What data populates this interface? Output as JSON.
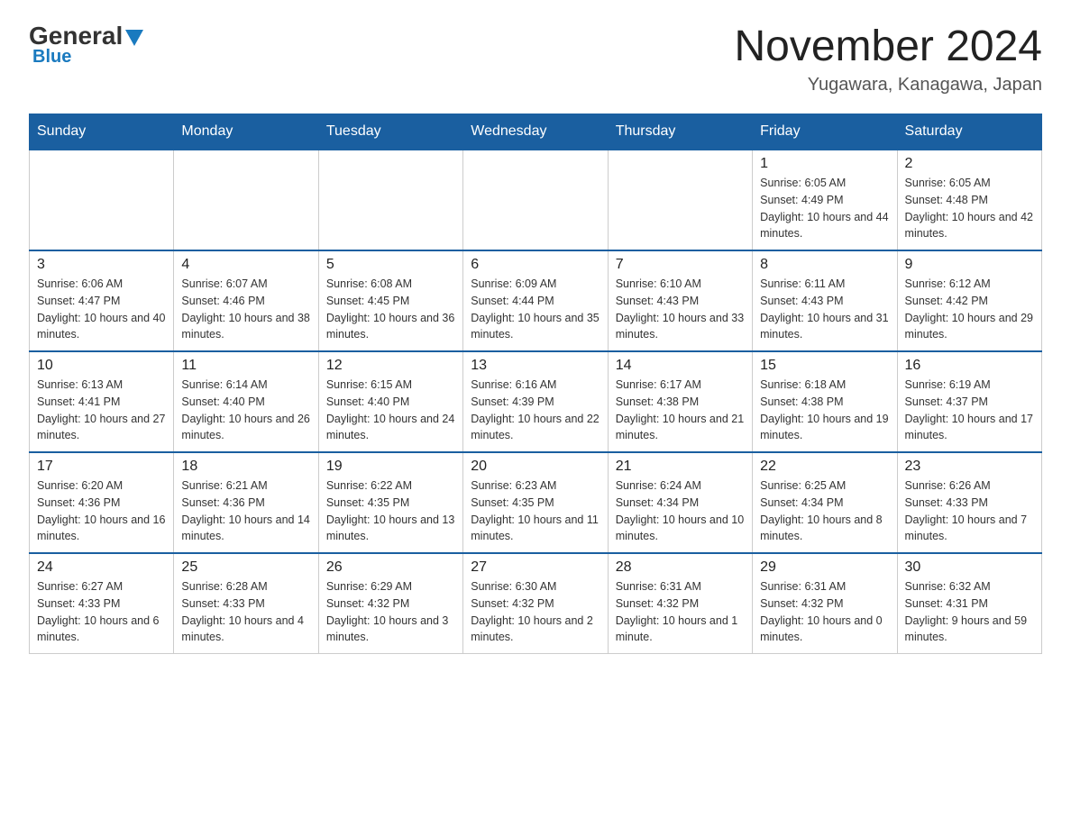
{
  "header": {
    "logo_general": "General",
    "logo_blue": "Blue",
    "month_title": "November 2024",
    "location": "Yugawara, Kanagawa, Japan"
  },
  "calendar": {
    "days_of_week": [
      "Sunday",
      "Monday",
      "Tuesday",
      "Wednesday",
      "Thursday",
      "Friday",
      "Saturday"
    ],
    "weeks": [
      [
        {
          "day": "",
          "info": ""
        },
        {
          "day": "",
          "info": ""
        },
        {
          "day": "",
          "info": ""
        },
        {
          "day": "",
          "info": ""
        },
        {
          "day": "",
          "info": ""
        },
        {
          "day": "1",
          "info": "Sunrise: 6:05 AM\nSunset: 4:49 PM\nDaylight: 10 hours and 44 minutes."
        },
        {
          "day": "2",
          "info": "Sunrise: 6:05 AM\nSunset: 4:48 PM\nDaylight: 10 hours and 42 minutes."
        }
      ],
      [
        {
          "day": "3",
          "info": "Sunrise: 6:06 AM\nSunset: 4:47 PM\nDaylight: 10 hours and 40 minutes."
        },
        {
          "day": "4",
          "info": "Sunrise: 6:07 AM\nSunset: 4:46 PM\nDaylight: 10 hours and 38 minutes."
        },
        {
          "day": "5",
          "info": "Sunrise: 6:08 AM\nSunset: 4:45 PM\nDaylight: 10 hours and 36 minutes."
        },
        {
          "day": "6",
          "info": "Sunrise: 6:09 AM\nSunset: 4:44 PM\nDaylight: 10 hours and 35 minutes."
        },
        {
          "day": "7",
          "info": "Sunrise: 6:10 AM\nSunset: 4:43 PM\nDaylight: 10 hours and 33 minutes."
        },
        {
          "day": "8",
          "info": "Sunrise: 6:11 AM\nSunset: 4:43 PM\nDaylight: 10 hours and 31 minutes."
        },
        {
          "day": "9",
          "info": "Sunrise: 6:12 AM\nSunset: 4:42 PM\nDaylight: 10 hours and 29 minutes."
        }
      ],
      [
        {
          "day": "10",
          "info": "Sunrise: 6:13 AM\nSunset: 4:41 PM\nDaylight: 10 hours and 27 minutes."
        },
        {
          "day": "11",
          "info": "Sunrise: 6:14 AM\nSunset: 4:40 PM\nDaylight: 10 hours and 26 minutes."
        },
        {
          "day": "12",
          "info": "Sunrise: 6:15 AM\nSunset: 4:40 PM\nDaylight: 10 hours and 24 minutes."
        },
        {
          "day": "13",
          "info": "Sunrise: 6:16 AM\nSunset: 4:39 PM\nDaylight: 10 hours and 22 minutes."
        },
        {
          "day": "14",
          "info": "Sunrise: 6:17 AM\nSunset: 4:38 PM\nDaylight: 10 hours and 21 minutes."
        },
        {
          "day": "15",
          "info": "Sunrise: 6:18 AM\nSunset: 4:38 PM\nDaylight: 10 hours and 19 minutes."
        },
        {
          "day": "16",
          "info": "Sunrise: 6:19 AM\nSunset: 4:37 PM\nDaylight: 10 hours and 17 minutes."
        }
      ],
      [
        {
          "day": "17",
          "info": "Sunrise: 6:20 AM\nSunset: 4:36 PM\nDaylight: 10 hours and 16 minutes."
        },
        {
          "day": "18",
          "info": "Sunrise: 6:21 AM\nSunset: 4:36 PM\nDaylight: 10 hours and 14 minutes."
        },
        {
          "day": "19",
          "info": "Sunrise: 6:22 AM\nSunset: 4:35 PM\nDaylight: 10 hours and 13 minutes."
        },
        {
          "day": "20",
          "info": "Sunrise: 6:23 AM\nSunset: 4:35 PM\nDaylight: 10 hours and 11 minutes."
        },
        {
          "day": "21",
          "info": "Sunrise: 6:24 AM\nSunset: 4:34 PM\nDaylight: 10 hours and 10 minutes."
        },
        {
          "day": "22",
          "info": "Sunrise: 6:25 AM\nSunset: 4:34 PM\nDaylight: 10 hours and 8 minutes."
        },
        {
          "day": "23",
          "info": "Sunrise: 6:26 AM\nSunset: 4:33 PM\nDaylight: 10 hours and 7 minutes."
        }
      ],
      [
        {
          "day": "24",
          "info": "Sunrise: 6:27 AM\nSunset: 4:33 PM\nDaylight: 10 hours and 6 minutes."
        },
        {
          "day": "25",
          "info": "Sunrise: 6:28 AM\nSunset: 4:33 PM\nDaylight: 10 hours and 4 minutes."
        },
        {
          "day": "26",
          "info": "Sunrise: 6:29 AM\nSunset: 4:32 PM\nDaylight: 10 hours and 3 minutes."
        },
        {
          "day": "27",
          "info": "Sunrise: 6:30 AM\nSunset: 4:32 PM\nDaylight: 10 hours and 2 minutes."
        },
        {
          "day": "28",
          "info": "Sunrise: 6:31 AM\nSunset: 4:32 PM\nDaylight: 10 hours and 1 minute."
        },
        {
          "day": "29",
          "info": "Sunrise: 6:31 AM\nSunset: 4:32 PM\nDaylight: 10 hours and 0 minutes."
        },
        {
          "day": "30",
          "info": "Sunrise: 6:32 AM\nSunset: 4:31 PM\nDaylight: 9 hours and 59 minutes."
        }
      ]
    ]
  }
}
